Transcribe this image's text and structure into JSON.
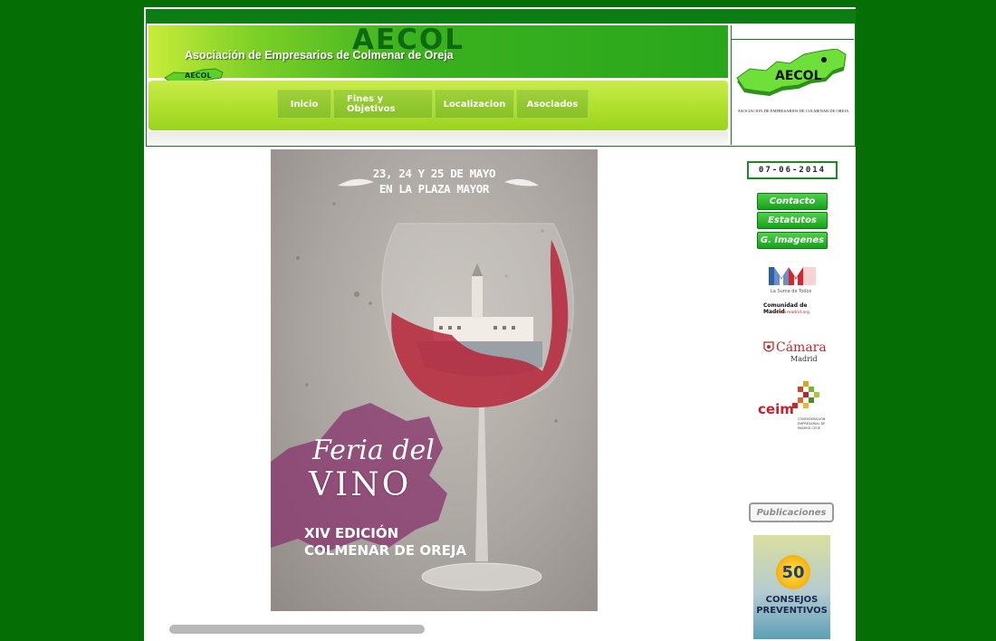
{
  "header": {
    "brand": "AECOL",
    "tagline": "Asociación de Empresarios de Colmenar de Oreja",
    "logo_brand": "AECOL",
    "logo_caption": "ASOCIACION DE EMPRESARIOS DE COLMENAR DE OREJA"
  },
  "nav": {
    "items": [
      {
        "label": "Inicio"
      },
      {
        "label": "Fines y Objetivos"
      },
      {
        "label": "Localizacion"
      },
      {
        "label": "Asociados"
      }
    ]
  },
  "poster": {
    "date_line1": "23, 24 Y 25 DE MAYO",
    "date_line2": "EN LA PLAZA MAYOR",
    "title_line1": "Feria del",
    "title_line2": "VINO",
    "edition_line1": "XIV EDICIÓN",
    "edition_line2": "COLMENAR DE OREJA"
  },
  "sidebar": {
    "date": "07-06-2014",
    "buttons": [
      {
        "label": "Contacto"
      },
      {
        "label": "Estatutos"
      },
      {
        "label": "G. Imagenes"
      }
    ],
    "partners": {
      "madrid_caption": "Comunidad de Madrid",
      "madrid_url": "www.madrid.org",
      "madrid_small": "La Suma de Todos",
      "camara_name": "Cámara",
      "camara_city": "Madrid",
      "ceim_name": "ceim",
      "ceim_caption": "CONFEDERACIÓN EMPRESARIAL DE MADRID CEOE"
    },
    "publications_label": "Publicaciones",
    "book_number": "50",
    "book_title_line1": "CONSEJOS",
    "book_title_line2": "PREVENTIVOS"
  },
  "colors": {
    "page_bg": "#056f05",
    "accent_green": "#17a11a",
    "lime": "#acde2a"
  }
}
